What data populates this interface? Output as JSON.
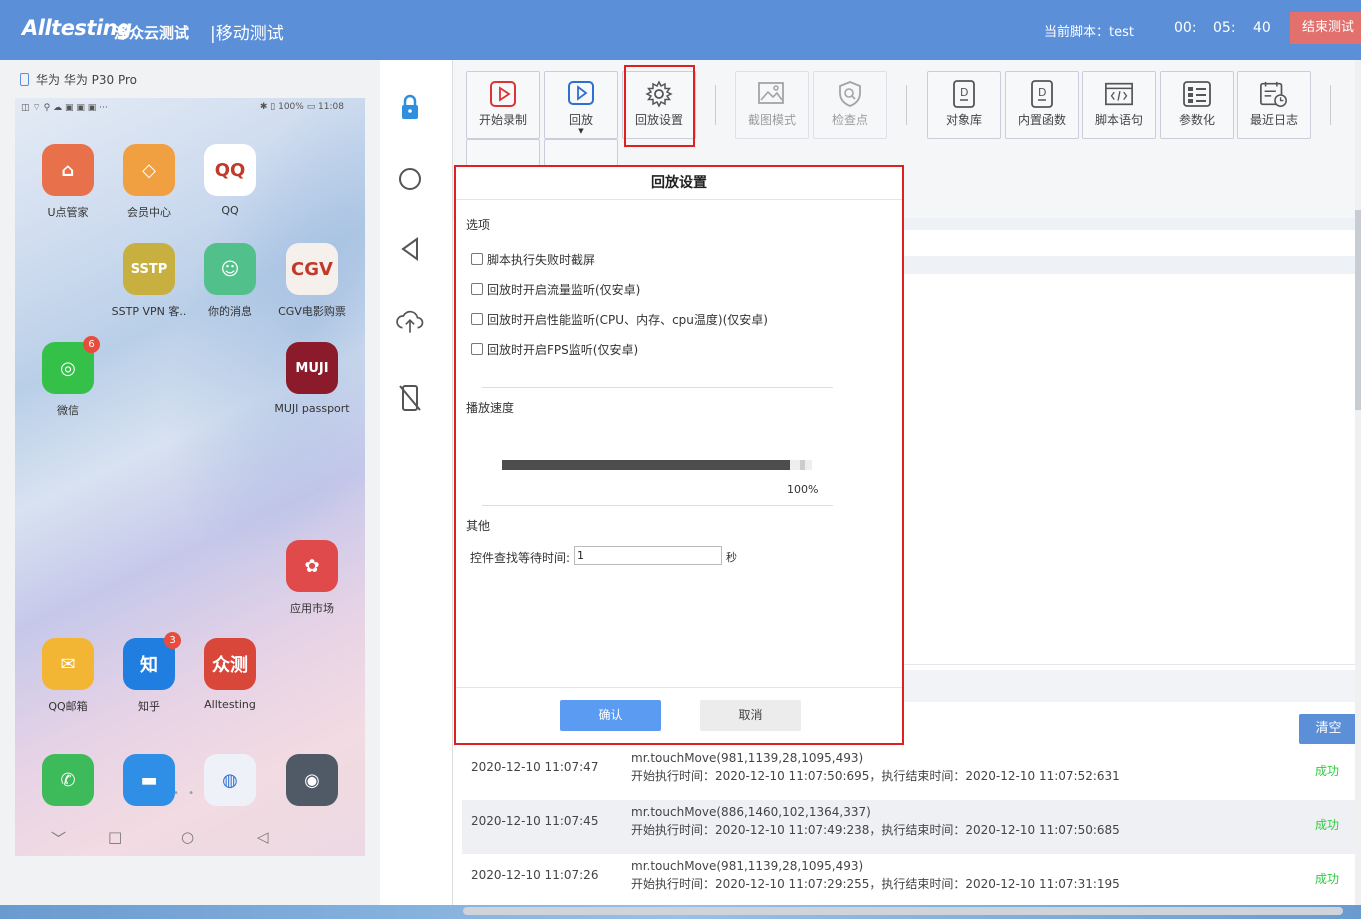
{
  "header": {
    "logo_text": "Alltesting",
    "logo_cn": "泽众云测试",
    "section_title": "|移动测试",
    "script_label": "当前脚本：test",
    "timer": {
      "h": "00:",
      "m": "05:",
      "s": "40"
    },
    "end_button": "结束测试"
  },
  "device": {
    "name": "华为 华为 P30 Pro",
    "status_left": "◫ ⌔ ⚲ ☁ ▣ ▣ ▣ ···",
    "status_right": "✱ ▯ 100% ▭ 11:08",
    "apps": [
      {
        "label": "U点管家",
        "glyph": "⌂",
        "color": "#e8704a"
      },
      {
        "label": "会员中心",
        "glyph": "◇",
        "color": "#f0a040"
      },
      {
        "label": "QQ",
        "glyph": "QQ",
        "color": "#ffffff"
      },
      {
        "label": "SSTP VPN 客..",
        "glyph": "SSTP",
        "color": "#c8b040"
      },
      {
        "label": "你的消息",
        "glyph": "☺",
        "color": "#52c08a"
      },
      {
        "label": "CGV电影购票",
        "glyph": "CGV",
        "color": "#f5f0ec"
      },
      {
        "label": "微信",
        "glyph": "◎",
        "color": "#35c04a",
        "badge": "6"
      },
      {
        "label": "MUJI passport",
        "glyph": "MUJI",
        "color": "#8b1a2a"
      },
      {
        "label": "应用市场",
        "glyph": "✿",
        "color": "#e04a4a"
      },
      {
        "label": "QQ邮箱",
        "glyph": "✉",
        "color": "#f2b534"
      },
      {
        "label": "知乎",
        "glyph": "知",
        "color": "#1f7ee0",
        "badge": "3"
      },
      {
        "label": "Alltesting",
        "glyph": "众测",
        "color": "#d9463a"
      }
    ],
    "dock": [
      {
        "glyph": "✆",
        "color": "#3dbb5a"
      },
      {
        "glyph": "▬",
        "color": "#2f8fe6"
      },
      {
        "glyph": "◍",
        "color": "#eef2f8"
      },
      {
        "glyph": "◉",
        "color": "#505a66"
      }
    ],
    "page_dots": "• • • •",
    "nav": {
      "back": "﹀",
      "recent": "□",
      "home": "○",
      "return": "◁"
    }
  },
  "controls": [
    "lock-icon",
    "circle-icon",
    "back-triangle-icon",
    "cloud-upload-icon",
    "no-phone-icon"
  ],
  "toolbar": {
    "start_record": "开始录制",
    "playback": "回放",
    "playback_settings": "回放设置",
    "screenshot_mode": "截图模式",
    "checkpoint": "检查点",
    "object_library": "对象库",
    "builtin_functions": "内置函数",
    "script_statements": "脚本语句",
    "parameterize": "参数化",
    "recent_logs": "最近日志"
  },
  "modal": {
    "title": "回放设置",
    "options_label": "选项",
    "options": [
      {
        "label": "脚本执行失败时截屏",
        "checked": false
      },
      {
        "label": "回放时开启流量监听(仅安卓)",
        "checked": false
      },
      {
        "label": "回放时开启性能监听(CPU、内存、cpu温度)(仅安卓)",
        "checked": false
      },
      {
        "label": "回放时开启FPS监听(仅安卓)",
        "checked": false
      }
    ],
    "speed_label": "播放速度",
    "speed_value": 1.0,
    "speed_pct": "100%",
    "other_label": "其他",
    "wait_label": "控件查找等待时间:",
    "wait_value": "1",
    "wait_unit": "秒",
    "confirm": "确认",
    "cancel": "取消"
  },
  "clear_button": "清空",
  "logs": [
    {
      "time": "2020-12-10 11:07:47",
      "cmd": "mr.touchMove(981,1139,28,1095,493)",
      "detail": "开始执行时间：2020-12-10 11:07:50:695，执行结束时间：2020-12-10 11:07:52:631",
      "status": "成功"
    },
    {
      "time": "2020-12-10 11:07:45",
      "cmd": "mr.touchMove(886,1460,102,1364,337)",
      "detail": "开始执行时间：2020-12-10 11:07:49:238，执行结束时间：2020-12-10 11:07:50:685",
      "status": "成功"
    },
    {
      "time": "2020-12-10 11:07:26",
      "cmd": "mr.touchMove(981,1139,28,1095,493)",
      "detail": "开始执行时间：2020-12-10 11:07:29:255，执行结束时间：2020-12-10 11:07:31:195",
      "status": "成功"
    }
  ],
  "colors": {
    "header_bg": "#5b8fd8",
    "accent": "#5b9cf2",
    "highlight": "#e02020",
    "success": "#2ecc40",
    "end_btn": "#e2706d"
  }
}
